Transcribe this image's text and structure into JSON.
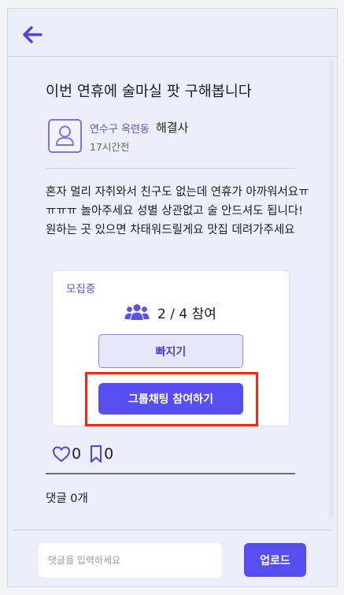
{
  "header": {
    "back_icon": "arrow-left-icon"
  },
  "post": {
    "title": "이번 연휴에 술마실 팟 구해봅니다",
    "author_location": "연수구 옥련동",
    "author_name": "해결사",
    "time_ago": "17시간전",
    "body": "혼자 멀리 자취와서 친구도 없는데 연휴가 아까워서요ㅠㅠㅠㅠ 놀아주세요 성별 상관없고 술 안드셔도 됩니다! 원하는 곳 있으면 차태워드릴게요 맛집 데려가주세요"
  },
  "recruit": {
    "status": "모집중",
    "participants": "2 / 4 참여",
    "leave_label": "빠지기",
    "join_label": "그룹채팅 참여하기"
  },
  "reactions": {
    "likes": "0",
    "bookmarks": "0"
  },
  "comments": {
    "count_label": "댓글 0개",
    "input_placeholder": "댓글을 입력하세요",
    "upload_label": "업로드"
  },
  "colors": {
    "accent": "#564eef",
    "accent_text": "#5a52e0",
    "background": "#eeeefb",
    "highlight": "#ee2a14"
  }
}
